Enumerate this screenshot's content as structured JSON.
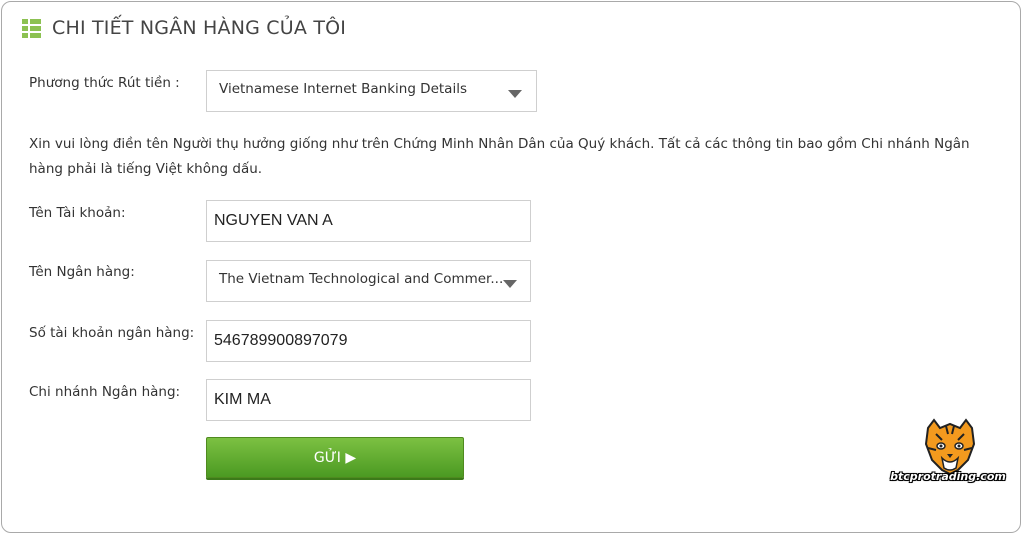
{
  "header": {
    "title": "CHI TIẾT NGÂN HÀNG CỦA TÔI",
    "icon": "list-icon",
    "accent_color": "#8cc152"
  },
  "form": {
    "withdraw_method": {
      "label": "Phương thức Rút tiền :",
      "value": "Vietnamese Internet Banking Details"
    },
    "note": "Xin vui lòng điền tên Người thụ hưởng giống như trên Chứng Minh Nhân Dân của Quý khách. Tất cả các thông tin bao gồm Chi nhánh Ngân hàng phải là tiếng Việt không dấu.",
    "account_name": {
      "label": "Tên Tài khoản:",
      "value": "NGUYEN VAN A"
    },
    "bank_name": {
      "label": "Tên Ngân hàng:",
      "value": "The Vietnam Technological and Commer..."
    },
    "account_number": {
      "label": "Số tài khoản ngân hàng:",
      "value": "546789900897079"
    },
    "branch": {
      "label": "Chi nhánh Ngân hàng:",
      "value": "KIM MA"
    },
    "submit_label": "GỬI ▶",
    "submit_color": "#5faa2c"
  },
  "watermark": {
    "text": "btcprotrading.com",
    "icon": "tiger-logo-icon"
  }
}
